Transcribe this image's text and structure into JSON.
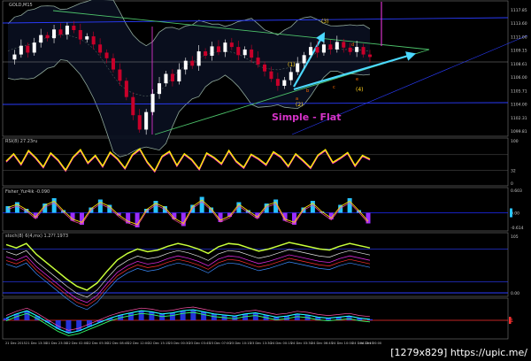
{
  "colors": {
    "background": "#000000",
    "panel_border": "#7a7a7a",
    "grid": "#2a2a2a",
    "scale_text": "#c8c8c8",
    "bull_candle": "#ffffff",
    "bear_candle": "#c8002a",
    "band_outer": "#8fa89a",
    "band_fill": "#0a1020",
    "channel_blue": "#2a3cff",
    "trend_green": "#4cc26a",
    "arrow_cyan": "#4bd8ff",
    "wave_label": "#ffd21e",
    "wave_sub": "#ff6a00",
    "title_magenta": "#d633c8",
    "rsi_yellow": "#ffee00",
    "rsi_magenta": "#ff33cc",
    "fisher_cyan": "#29c4ff",
    "fisher_purple": "#9a2cff",
    "stoch_green": "#c8ff3a",
    "stoch_white": "#e6e6e6",
    "stoch_blue": "#2c3cff",
    "stoch_red": "#ff3030",
    "stoch_magenta": "#d428d4",
    "macd_blue": "#2a3cff",
    "macd_cyan": "#22ffff",
    "macd_green": "#33ff66",
    "macd_red": "#ff3030"
  },
  "main": {
    "title": "GOLD,M15",
    "annotation": "Simple - Flat",
    "price_labels": [
      "1117.85",
      "1113.60",
      "1111.00",
      "1109.15",
      "1108.61",
      "1106.00",
      "1105.71",
      "1104.00",
      "1102.31",
      "1099.81"
    ],
    "wave_labels": [
      {
        "text": "(3)",
        "color": "yellow"
      },
      {
        "text": "(1)",
        "color": "yellow"
      },
      {
        "text": "(2)",
        "color": "yellow"
      },
      {
        "text": "(4)",
        "color": "yellow"
      },
      {
        "text": "a",
        "color": "orange"
      },
      {
        "text": "b",
        "color": "orange"
      },
      {
        "text": "c",
        "color": "orange"
      },
      {
        "text": "d",
        "color": "orange"
      },
      {
        "text": "e",
        "color": "orange"
      }
    ]
  },
  "rsi": {
    "title": "RSI(8) 27.23ru",
    "scale": [
      "100",
      "32",
      "0"
    ]
  },
  "fisher": {
    "title": "Fisher_Yur4ik -0.090",
    "scale": [
      "0.603",
      "0.00",
      "-0.614"
    ]
  },
  "stoch": {
    "title": "stoch(8) 6(4,mx) 1.2??.1973",
    "scale": [
      "105",
      "0.00"
    ]
  },
  "macd": {
    "scale": [
      "1"
    ]
  },
  "time_axis": [
    "21 Dec 2015",
    "21 Dec 13:30",
    "21 Dec 23:30",
    "22 Dec 02:00",
    "22 Dec 05:30",
    "22 Dec 08:45",
    "22 Dec 12:00",
    "22 Dec 15:15",
    "23 Dec 00:30",
    "23 Dec 03:45",
    "23 Dec 07:00",
    "23 Dec 10:15",
    "23 Dec 13:30",
    "24 Dec 00:15",
    "24 Dec 03:30",
    "24 Dec 06:45",
    "24 Dec 10:00",
    "24 Dec 13:15",
    "24 Dec 20:00"
  ],
  "watermark": "[1279x829] https://upic.me/",
  "chart_data": {
    "type": "line",
    "title": "GOLD,M15",
    "series": [
      {
        "name": "GOLD,M15",
        "values": [
          1110.2,
          1111.0,
          1112.4,
          1111.3,
          1112.9,
          1114.1,
          1113.6,
          1115.0,
          1114.2,
          1115.6,
          1114.9,
          1113.4,
          1113.9,
          1112.6,
          1111.3,
          1110.4,
          1108.6,
          1106.8,
          1104.2,
          1101.3,
          1099.0,
          1101.8,
          1104.7,
          1106.4,
          1107.9,
          1106.7,
          1108.6,
          1110.0,
          1109.2,
          1111.5,
          1110.8,
          1112.3,
          1111.4,
          1112.9,
          1112.2,
          1110.9,
          1111.8,
          1110.5,
          1109.4,
          1108.3,
          1107.1,
          1106.0,
          1106.9,
          1108.2,
          1109.6,
          1110.9,
          1112.2,
          1111.3,
          1112.6,
          1111.8,
          1113.0,
          1112.1,
          1111.4,
          1112.2,
          1111.0,
          1110.6
        ]
      }
    ],
    "ylim": [
      1098.5,
      1119.0
    ],
    "grid": false,
    "annotations": [
      "Simple - Flat",
      "(1)",
      "(2)",
      "(3)",
      "(4)",
      "a",
      "b",
      "c",
      "d",
      "e"
    ],
    "rsi_values": [
      52,
      70,
      45,
      78,
      60,
      38,
      72,
      55,
      30,
      62,
      80,
      48,
      66,
      40,
      74,
      58,
      35,
      68,
      82,
      50,
      28,
      64,
      76,
      42,
      70,
      56,
      33,
      72,
      61,
      46,
      78,
      52,
      37,
      69,
      58,
      44,
      75,
      63,
      40,
      70,
      54,
      36,
      67,
      80,
      49,
      60,
      73,
      41,
      66,
      57
    ],
    "fisher_values": [
      0.25,
      0.4,
      0.15,
      -0.2,
      0.35,
      0.55,
      0.1,
      -0.3,
      -0.45,
      0.2,
      0.5,
      0.3,
      -0.1,
      -0.4,
      -0.55,
      0.15,
      0.45,
      0.25,
      -0.25,
      -0.5,
      0.3,
      0.6,
      0.2,
      -0.35,
      -0.15,
      0.4,
      0.1,
      -0.2,
      0.35,
      0.5,
      -0.3,
      -0.45,
      0.2,
      0.45,
      0.05,
      -0.25,
      0.3,
      0.55,
      0.1,
      -0.4
    ],
    "stoch_values": [
      88,
      82,
      90,
      70,
      55,
      40,
      25,
      12,
      5,
      18,
      40,
      60,
      72,
      80,
      75,
      78,
      85,
      90,
      86,
      80,
      72,
      84,
      90,
      88,
      82,
      76,
      80,
      86,
      92,
      88,
      84,
      80,
      78,
      85,
      90,
      86,
      82
    ],
    "macd_values": [
      0.2,
      0.6,
      0.9,
      0.4,
      -0.2,
      -0.8,
      -1.2,
      -1.0,
      -0.6,
      -0.2,
      0.2,
      0.5,
      0.7,
      0.9,
      0.8,
      0.6,
      0.7,
      0.9,
      1.0,
      0.8,
      0.6,
      0.5,
      0.4,
      0.6,
      0.7,
      0.5,
      0.3,
      0.4,
      0.6,
      0.5,
      0.3,
      0.2,
      0.3,
      0.4,
      0.2,
      0.1
    ]
  }
}
